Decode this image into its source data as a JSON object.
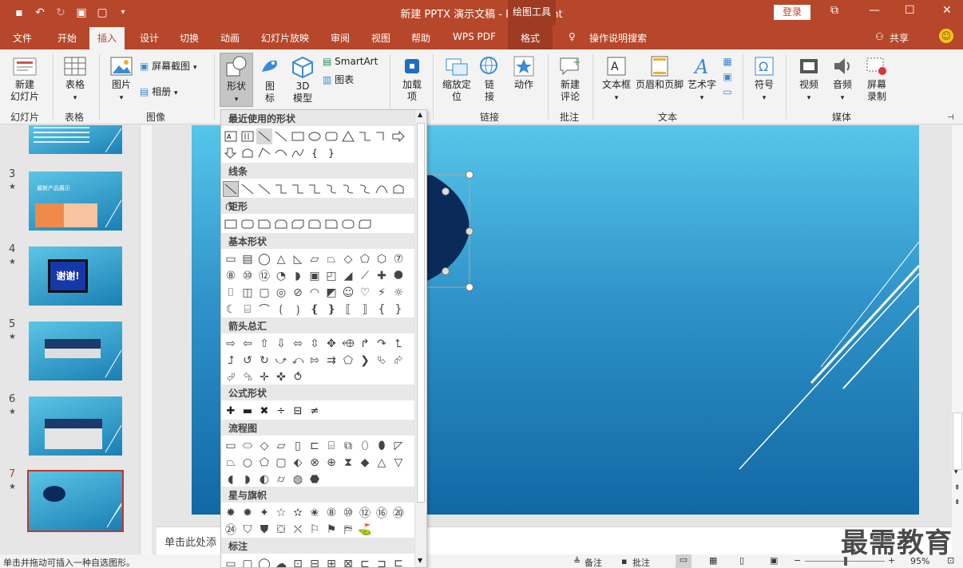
{
  "title_bar": {
    "doc_title": "新建 PPTX 演示文稿 - PowerPoint",
    "context_tool": "绘图工具",
    "login": "登录"
  },
  "tabs": [
    "文件",
    "开始",
    "插入",
    "设计",
    "切换",
    "动画",
    "幻灯片放映",
    "审阅",
    "视图",
    "帮助",
    "WPS PDF",
    "格式"
  ],
  "active_tab": "插入",
  "tell_me": "操作说明搜索",
  "share": "共享",
  "ribbon": {
    "new_slide": "新建\n幻灯片",
    "table": "表格",
    "picture": "图片",
    "screenshot": "屏幕截图",
    "album": "相册",
    "shapes": "形状",
    "icons": "图\n标",
    "model3d": "3D\n模型",
    "smartart": "SmartArt",
    "chart": "图表",
    "addins": "加载\n项",
    "zoom": "缩放定\n位",
    "link": "链\n接",
    "action": "动作",
    "new_comment": "新建\n评论",
    "textbox": "文本框",
    "header_footer": "页眉和页脚",
    "wordart": "艺术字",
    "symbol": "符号",
    "video": "视频",
    "audio": "音频",
    "screen_record": "屏幕\n录制",
    "groups": {
      "slides": "幻灯片",
      "tables": "表格",
      "images": "图像",
      "links": "链接",
      "comments": "批注",
      "text": "文本",
      "media": "媒体"
    }
  },
  "thumbnails": [
    {
      "num": "3",
      "label": "最新产品展示"
    },
    {
      "num": "4",
      "label": "谢谢!"
    },
    {
      "num": "5",
      "label": ""
    },
    {
      "num": "6",
      "label": ""
    },
    {
      "num": "7",
      "label": ""
    }
  ],
  "shapes_gallery": {
    "sections": [
      "最近使用的形状",
      "线条",
      "矩形",
      "基本形状",
      "箭头总汇",
      "公式形状",
      "流程图",
      "星与旗帜",
      "标注"
    ]
  },
  "notes_placeholder": "单击此处添",
  "status": {
    "hint": "单击并拖动可插入一种自选图形。",
    "notes": "备注",
    "comments": "批注",
    "zoom": "95%"
  },
  "watermark": "最需教育"
}
